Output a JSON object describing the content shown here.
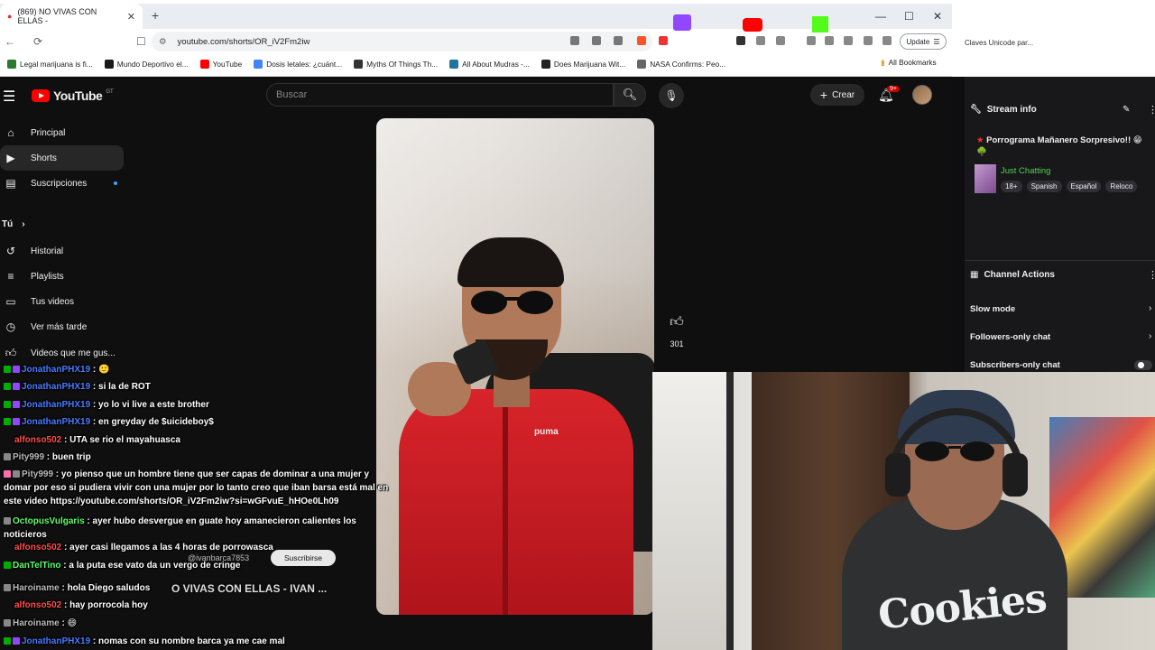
{
  "browser": {
    "tab_title": "(869) NO VIVAS CON ELLAS -",
    "url": "youtube.com/shorts/OR_iV2Fm2iw",
    "update_label": "Update",
    "all_bookmarks": "All Bookmarks",
    "bookmarks": [
      {
        "label": "Legal marijuana is fi...",
        "color": "#2c7a2c"
      },
      {
        "label": "Mundo Deportivo el...",
        "color": "#1a1a1a"
      },
      {
        "label": "YouTube",
        "color": "#ff0000"
      },
      {
        "label": "Dosis letales: ¿cuánt...",
        "color": "#4285f4"
      },
      {
        "label": "Myths Of Things Th...",
        "color": "#333333"
      },
      {
        "label": "All About Mudras -...",
        "color": "#21759b"
      },
      {
        "label": "Does Marijuana Wit...",
        "color": "#222222"
      },
      {
        "label": "NASA Confirms: Peo...",
        "color": "#666666"
      }
    ],
    "right_window_tab": "Claves Unicode par..."
  },
  "youtube": {
    "logo_text": "YouTube",
    "country_code": "GT",
    "search_placeholder": "Buscar",
    "create_label": "Crear",
    "notification_count": "9+",
    "sidebar": {
      "items": [
        {
          "label": "Principal",
          "icon": "home-icon"
        },
        {
          "label": "Shorts",
          "icon": "shorts-icon"
        },
        {
          "label": "Suscripciones",
          "icon": "subscriptions-icon"
        }
      ],
      "you_header": "Tú",
      "you_items": [
        {
          "label": "Historial",
          "icon": "history-icon"
        },
        {
          "label": "Playlists",
          "icon": "playlists-icon"
        },
        {
          "label": "Tus videos",
          "icon": "your-videos-icon"
        },
        {
          "label": "Ver más tarde",
          "icon": "watch-later-icon"
        },
        {
          "label": "Videos que me gus...",
          "icon": "liked-icon"
        }
      ]
    },
    "short": {
      "like_count": "301",
      "title_overlay": "O VIVAS CON ELLAS - IVAN ...",
      "channel_handle": "@ivanbarca7853",
      "subscribe_label": "Suscribirse",
      "shirt_text": "puma"
    }
  },
  "twitch": {
    "stream_info_label": "Stream info",
    "stream_title": "Porrograma Mañanero Sorpresivo!! 😁 🌳",
    "category": "Just Chatting",
    "tags": [
      "18+",
      "Spanish",
      "Español",
      "Reloco"
    ],
    "channel_actions_label": "Channel Actions",
    "actions": [
      "Slow mode",
      "Followers-only chat",
      "Subscribers-only chat"
    ]
  },
  "webcam": {
    "hoodie_text": "Cookies"
  },
  "chat": [
    {
      "user": "JonathanPHX19",
      "text": ": 🙂",
      "color": "blue",
      "badges": [
        "mod",
        "sub"
      ]
    },
    {
      "user": "JonathanPHX19",
      "text": ": si la de ROT",
      "color": "blue",
      "badges": [
        "mod",
        "sub"
      ]
    },
    {
      "user": "JonathanPHX19",
      "text": ": yo lo vi live a este brother",
      "color": "blue",
      "badges": [
        "mod",
        "sub"
      ]
    },
    {
      "user": "JonathanPHX19",
      "text": ": en greyday de $uicideboy$",
      "color": "blue",
      "badges": [
        "mod",
        "sub"
      ]
    },
    {
      "user": "alfonso502",
      "text": ": UTA se rio el mayahuasca",
      "color": "red",
      "badges": []
    },
    {
      "user": "Pity999",
      "text": ": buen trip",
      "color": "gray",
      "badges": [
        "gray"
      ]
    },
    {
      "user": "Pity999",
      "text": ": yo pienso que un hombre tiene que ser capas de dominar a una mujer y domar por eso si pudiera vivir con una mujer por lo tanto creo que iban barsa está mal en este video https://youtube.com/shorts/OR_iV2Fm2iw?si=wGFvuE_hHOe0Lh09",
      "color": "gray",
      "badges": [
        "pink",
        "gray"
      ]
    },
    {
      "user": "OctopusVulgaris",
      "text": ": ayer hubo desvergue en guate hoy amanecieron calientes los noticieros",
      "color": "green",
      "badges": [
        "gray"
      ]
    },
    {
      "user": "alfonso502",
      "text": ": ayer casi llegamos a las 4 horas de porrowasca",
      "color": "red",
      "badges": []
    },
    {
      "user": "DanTelTino",
      "text": ": a la puta ese vato da un vergo de cringe",
      "color": "green",
      "badges": [
        "mod"
      ]
    },
    {
      "user": "Haroiname",
      "text": ": hola Diego saludos",
      "color": "gray",
      "badges": [
        "gray"
      ]
    },
    {
      "user": "alfonso502",
      "text": ": hay porrocola hoy",
      "color": "red",
      "badges": []
    },
    {
      "user": "Haroiname",
      "text": ": 😄",
      "color": "gray",
      "badges": [
        "gray"
      ]
    },
    {
      "user": "JonathanPHX19",
      "text": ": nomas con su nombre barca ya me cae mal",
      "color": "blue",
      "badges": [
        "mod",
        "sub"
      ]
    }
  ]
}
